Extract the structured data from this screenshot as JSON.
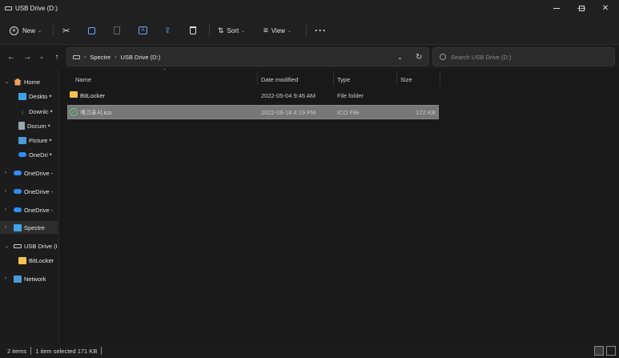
{
  "window": {
    "title": "USB Drive (D:)"
  },
  "toolbar": {
    "new_label": "New",
    "sort_label": "Sort",
    "view_label": "View"
  },
  "address": {
    "crumbs": [
      "Spectre",
      "USB Drive (D:)"
    ]
  },
  "search": {
    "placeholder": "Search USB Drive (D:)"
  },
  "sidebar": {
    "items": [
      {
        "label": "Home"
      },
      {
        "label": "Deskto"
      },
      {
        "label": "Downlc"
      },
      {
        "label": "Docum"
      },
      {
        "label": "Picture"
      },
      {
        "label": "OneDri"
      },
      {
        "label": "OneDrive -"
      },
      {
        "label": "OneDrive -"
      },
      {
        "label": "OneDrive -"
      },
      {
        "label": "Spectre"
      },
      {
        "label": "USB Drive (I"
      },
      {
        "label": "BitLocker"
      },
      {
        "label": "Network"
      }
    ]
  },
  "columns": {
    "name": "Name",
    "date": "Date modified",
    "type": "Type",
    "size": "Size"
  },
  "files": [
    {
      "name": "BitLocker",
      "date": "2022-05-04 9:46 AM",
      "type": "File folder",
      "size": ""
    },
    {
      "name": "체크표시.ico",
      "date": "2022-08-18 4:19 PM",
      "type": "ICO File",
      "size": "172 KB"
    }
  ],
  "status": {
    "count": "2 items",
    "selected": "1 item selected  171 KB"
  },
  "colors": {
    "accent_folder": "#f2c14e",
    "onedrive": "#2f8ef3",
    "selected_row": "#777777"
  }
}
